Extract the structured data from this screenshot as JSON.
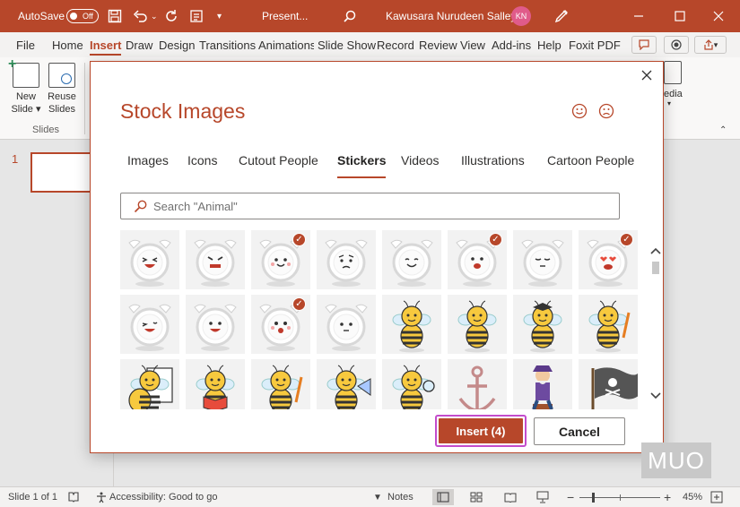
{
  "titlebar": {
    "autosave_label": "AutoSave",
    "autosave_state": "Off",
    "filename": "Present...",
    "user_name": "Kawusara Nurudeen Salley",
    "user_initials": "KN"
  },
  "menu": {
    "items": [
      "File",
      "Home",
      "Insert",
      "Draw",
      "Design",
      "Transitions",
      "Animations",
      "Slide Show",
      "Record",
      "Review",
      "View",
      "Add-ins",
      "Help",
      "Foxit PDF"
    ],
    "active": "Insert"
  },
  "ribbon": {
    "new_slide": [
      "New",
      "Slide"
    ],
    "reuse_slides": [
      "Reuse",
      "Slides"
    ],
    "group_label": "Slides",
    "media_label": "edia"
  },
  "thumbnails": {
    "slide_number": "1"
  },
  "dialog": {
    "title": "Stock Images",
    "tabs": [
      "Images",
      "Icons",
      "Cutout People",
      "Stickers",
      "Videos",
      "Illustrations",
      "Cartoon People"
    ],
    "active_tab": "Stickers",
    "search_placeholder": "Search \"Animal\"",
    "insert_label": "Insert (4)",
    "cancel_label": "Cancel",
    "stickers": [
      {
        "name": "alarm-clock-laughing",
        "checked": false
      },
      {
        "name": "alarm-clock-angry",
        "checked": false
      },
      {
        "name": "alarm-clock-happy",
        "checked": true
      },
      {
        "name": "alarm-clock-worried",
        "checked": false
      },
      {
        "name": "alarm-clock-smiling",
        "checked": false
      },
      {
        "name": "alarm-clock-shocked",
        "checked": true
      },
      {
        "name": "alarm-clock-sleepy",
        "checked": false
      },
      {
        "name": "alarm-clock-in-love",
        "checked": true
      },
      {
        "name": "alarm-clock-winking",
        "checked": false
      },
      {
        "name": "alarm-clock-grinning",
        "checked": false
      },
      {
        "name": "alarm-clock-surprised",
        "checked": true
      },
      {
        "name": "alarm-clock-neutral",
        "checked": false
      },
      {
        "name": "bee-waving",
        "checked": false
      },
      {
        "name": "bee-smiling",
        "checked": false
      },
      {
        "name": "bee-graduate",
        "checked": false
      },
      {
        "name": "bee-with-pencil",
        "checked": false
      },
      {
        "name": "bee-with-board",
        "checked": false
      },
      {
        "name": "bee-reading-book",
        "checked": false
      },
      {
        "name": "bee-holding-pencil",
        "checked": false
      },
      {
        "name": "bee-with-megaphone",
        "checked": false
      },
      {
        "name": "bee-with-magnifier",
        "checked": false
      },
      {
        "name": "anchor",
        "checked": false
      },
      {
        "name": "pirate-captain",
        "checked": false
      },
      {
        "name": "pirate-flag",
        "checked": false
      }
    ]
  },
  "status": {
    "slide_info": "Slide 1 of 1",
    "accessibility": "Accessibility: Good to go",
    "notes": "Notes",
    "zoom": "45%"
  },
  "watermark": "MUO",
  "colors": {
    "accent": "#b7472a",
    "insert_highlight": "#c34ccc"
  }
}
